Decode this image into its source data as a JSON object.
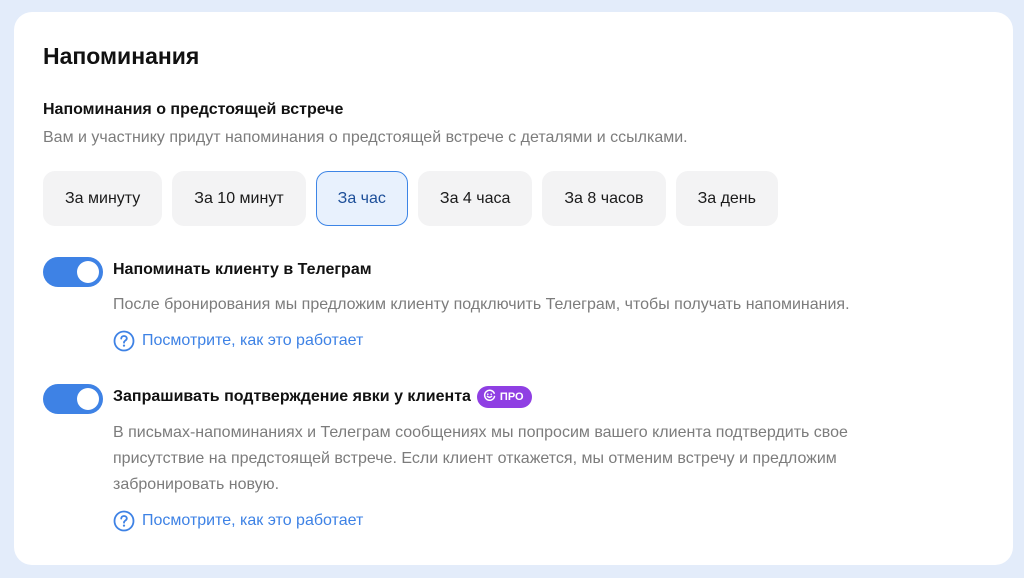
{
  "page": {
    "title": "Напоминания"
  },
  "section": {
    "heading": "Напоминания о предстоящей встрече",
    "description": "Вам и участнику придут напоминания о предстоящей встрече с деталями и ссылками."
  },
  "time_options": [
    {
      "label": "За минуту",
      "selected": false
    },
    {
      "label": "За 10 минут",
      "selected": false
    },
    {
      "label": "За час",
      "selected": true
    },
    {
      "label": "За 4 часа",
      "selected": false
    },
    {
      "label": "За 8 часов",
      "selected": false
    },
    {
      "label": "За день",
      "selected": false
    }
  ],
  "telegram_option": {
    "enabled": true,
    "title": "Напоминать клиенту в Телеграм",
    "description": "После бронирования мы предложим клиенту подключить Телеграм, чтобы получать напоминания.",
    "help_link": "Посмотрите, как это работает"
  },
  "confirmation_option": {
    "enabled": true,
    "title": "Запрашивать подтверждение явки у клиента",
    "badge": "ПРО",
    "description_line1": "В письмах-напоминаниях и Телеграм сообщениях мы попросим вашего клиента подтвердить свое",
    "description_line2": "присутствие на предстоящей встрече. Если клиент откажется, мы отменим встречу и предложим",
    "description_line3": "забронировать новую.",
    "help_link": "Посмотрите, как это работает"
  },
  "colors": {
    "accent": "#3e82e5",
    "pro_badge": "#8f3fe3",
    "chip_bg": "#f3f3f4",
    "chip_active_bg": "#e8f1fd",
    "muted_text": "#7c7c7c",
    "page_bg": "#e3ecfa"
  },
  "icons": {
    "help": "question-circle-icon",
    "pro": "smile-icon"
  }
}
